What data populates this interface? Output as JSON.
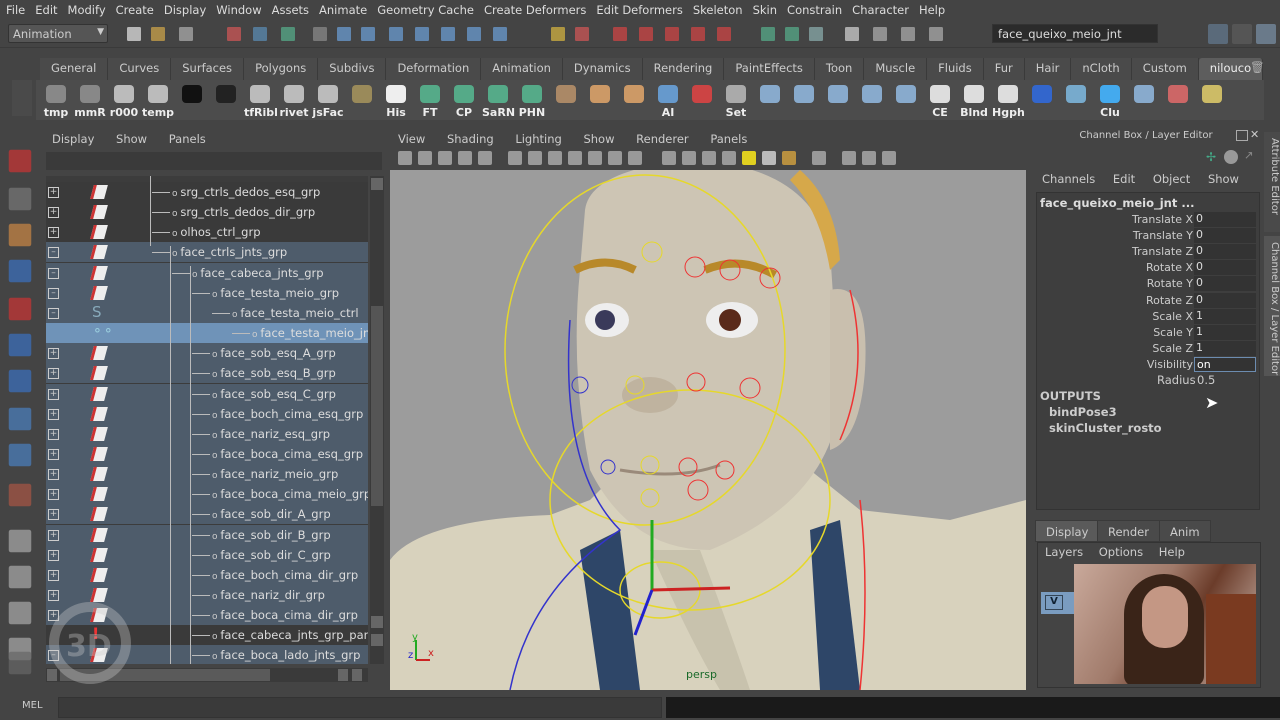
{
  "menubar": [
    "File",
    "Edit",
    "Modify",
    "Create",
    "Display",
    "Window",
    "Assets",
    "Animate",
    "Geometry Cache",
    "Create Deformers",
    "Edit Deformers",
    "Skeleton",
    "Skin",
    "Constrain",
    "Character",
    "Help"
  ],
  "status_line": {
    "mode": "Animation",
    "name_field": "face_queixo_meio_jnt"
  },
  "shelf_tabs": [
    "General",
    "Curves",
    "Surfaces",
    "Polygons",
    "Subdivs",
    "Deformation",
    "Animation",
    "Dynamics",
    "Rendering",
    "PaintEffects",
    "Toon",
    "Muscle",
    "Fluids",
    "Fur",
    "Hair",
    "nCloth",
    "Custom",
    "nilouco"
  ],
  "shelf_active": "nilouco",
  "shelf_buttons": [
    {
      "label": "tmp",
      "icon": "python-icon",
      "color": "#888"
    },
    {
      "label": "mmR",
      "icon": "python-icon",
      "color": "#888"
    },
    {
      "label": "r000",
      "icon": "maya-icon",
      "color": "#bbb"
    },
    {
      "label": "temp",
      "icon": "maya-icon",
      "color": "#bbb"
    },
    {
      "label": "",
      "icon": "3d-logo-icon",
      "color": "#111"
    },
    {
      "label": "",
      "icon": "3d-color-logo-icon",
      "color": "#222"
    },
    {
      "label": "tfRibl",
      "icon": "maya-icon",
      "color": "#bbb"
    },
    {
      "label": "rivet",
      "icon": "maya-icon",
      "color": "#bbb"
    },
    {
      "label": "jsFac",
      "icon": "maya-icon",
      "color": "#bbb"
    },
    {
      "label": "",
      "icon": "cube-icon",
      "color": "#9a8a5a"
    },
    {
      "label": "His",
      "icon": "pencil-icon",
      "color": "#eee"
    },
    {
      "label": "FT",
      "icon": "axes-icon",
      "color": "#5a8"
    },
    {
      "label": "CP",
      "icon": "axes-icon",
      "color": "#5a8"
    },
    {
      "label": "SaRN",
      "icon": "axes-icon",
      "color": "#5a8"
    },
    {
      "label": "PHN",
      "icon": "axes-icon",
      "color": "#5a8"
    },
    {
      "label": "",
      "icon": "skeleton-icon",
      "color": "#a86"
    },
    {
      "label": "",
      "icon": "head-icon",
      "color": "#c96"
    },
    {
      "label": "",
      "icon": "heads-icon",
      "color": "#c96"
    },
    {
      "label": "AI",
      "icon": "joint-icon",
      "color": "#69c"
    },
    {
      "label": "",
      "icon": "paint-icon",
      "color": "#c44"
    },
    {
      "label": "Set",
      "icon": "key-icon",
      "color": "#aaa"
    },
    {
      "label": "",
      "icon": "spheres-icon",
      "color": "#8ac"
    },
    {
      "label": "",
      "icon": "spheres-add-icon",
      "color": "#8ac"
    },
    {
      "label": "",
      "icon": "paint-spheres-icon",
      "color": "#8ac"
    },
    {
      "label": "",
      "icon": "joint-chain-icon",
      "color": "#8ac"
    },
    {
      "label": "",
      "icon": "joint-mirror-icon",
      "color": "#8ac"
    },
    {
      "label": "CE",
      "icon": "window-icon",
      "color": "#ddd"
    },
    {
      "label": "Blnd",
      "icon": "window-icon",
      "color": "#ddd"
    },
    {
      "label": "Hgph",
      "icon": "window-icon",
      "color": "#ddd"
    },
    {
      "label": "",
      "icon": "bone-icon",
      "color": "#36c"
    },
    {
      "label": "",
      "icon": "bucket-icon",
      "color": "#7ac"
    },
    {
      "label": "Clu",
      "icon": "cluster-icon",
      "color": "#4ae"
    },
    {
      "label": "",
      "icon": "paint-weights-icon",
      "color": "#8ac"
    },
    {
      "label": "",
      "icon": "cone-icon",
      "color": "#c66"
    },
    {
      "label": "",
      "icon": "map-icon",
      "color": "#cb6"
    }
  ],
  "outliner": {
    "menu": [
      "Display",
      "Show",
      "Panels"
    ],
    "rows": [
      {
        "name": "srg_ctrls_dedos_esq_grp",
        "level": 0,
        "exp": "+",
        "icon": "transform",
        "bg": "dark"
      },
      {
        "name": "srg_ctrls_dedos_dir_grp",
        "level": 0,
        "exp": "+",
        "icon": "transform",
        "bg": "dark"
      },
      {
        "name": "olhos_ctrl_grp",
        "level": 0,
        "exp": "+",
        "icon": "transform",
        "bg": "dark"
      },
      {
        "name": "face_ctrls_jnts_grp",
        "level": 0,
        "exp": "-",
        "icon": "transform",
        "bg": "sel"
      },
      {
        "name": "face_cabeca_jnts_grp",
        "level": 1,
        "exp": "-",
        "icon": "transform",
        "bg": "sel"
      },
      {
        "name": "face_testa_meio_grp",
        "level": 2,
        "exp": "-",
        "icon": "transform",
        "bg": "sel"
      },
      {
        "name": "face_testa_meio_ctrl",
        "level": 3,
        "exp": "-",
        "icon": "curve",
        "bg": "sel"
      },
      {
        "name": "face_testa_meio_jnt",
        "level": 4,
        "exp": "",
        "icon": "joint",
        "bg": "hi"
      },
      {
        "name": "face_sob_esq_A_grp",
        "level": 2,
        "exp": "+",
        "icon": "transform",
        "bg": "sel"
      },
      {
        "name": "face_sob_esq_B_grp",
        "level": 2,
        "exp": "+",
        "icon": "transform",
        "bg": "sel"
      },
      {
        "name": "face_sob_esq_C_grp",
        "level": 2,
        "exp": "+",
        "icon": "transform",
        "bg": "sel"
      },
      {
        "name": "face_boch_cima_esq_grp",
        "level": 2,
        "exp": "+",
        "icon": "transform",
        "bg": "sel"
      },
      {
        "name": "face_nariz_esq_grp",
        "level": 2,
        "exp": "+",
        "icon": "transform",
        "bg": "sel"
      },
      {
        "name": "face_boca_cima_esq_grp",
        "level": 2,
        "exp": "+",
        "icon": "transform",
        "bg": "sel"
      },
      {
        "name": "face_nariz_meio_grp",
        "level": 2,
        "exp": "+",
        "icon": "transform",
        "bg": "sel"
      },
      {
        "name": "face_boca_cima_meio_grp",
        "level": 2,
        "exp": "+",
        "icon": "transform",
        "bg": "sel"
      },
      {
        "name": "face_sob_dir_A_grp",
        "level": 2,
        "exp": "+",
        "icon": "transform",
        "bg": "sel"
      },
      {
        "name": "face_sob_dir_B_grp",
        "level": 2,
        "exp": "+",
        "icon": "transform",
        "bg": "sel"
      },
      {
        "name": "face_sob_dir_C_grp",
        "level": 2,
        "exp": "+",
        "icon": "transform",
        "bg": "sel"
      },
      {
        "name": "face_boch_cima_dir_grp",
        "level": 2,
        "exp": "+",
        "icon": "transform",
        "bg": "sel"
      },
      {
        "name": "face_nariz_dir_grp",
        "level": 2,
        "exp": "+",
        "icon": "transform",
        "bg": "sel"
      },
      {
        "name": "face_boca_cima_dir_grp",
        "level": 2,
        "exp": "+",
        "icon": "transform",
        "bg": "sel"
      },
      {
        "name": "face_cabeca_jnts_grp_parentC",
        "level": 2,
        "exp": "",
        "icon": "warn",
        "bg": "dark"
      },
      {
        "name": "face_boca_lado_jnts_grp",
        "level": 2,
        "exp": "-",
        "icon": "transform",
        "bg": "sel"
      }
    ]
  },
  "viewport": {
    "menu": [
      "View",
      "Shading",
      "Lighting",
      "Show",
      "Renderer",
      "Panels"
    ],
    "camera_label": "persp",
    "axis": {
      "x": "x",
      "y": "y",
      "z": "z"
    }
  },
  "channel_box": {
    "title": "Channel Box / Layer Editor",
    "menu": [
      "Channels",
      "Edit",
      "Object",
      "Show"
    ],
    "object": "face_queixo_meio_jnt ...",
    "attrs": [
      {
        "name": "Translate X",
        "value": "0"
      },
      {
        "name": "Translate Y",
        "value": "0"
      },
      {
        "name": "Translate Z",
        "value": "0"
      },
      {
        "name": "Rotate X",
        "value": "0"
      },
      {
        "name": "Rotate Y",
        "value": "0"
      },
      {
        "name": "Rotate Z",
        "value": "0"
      },
      {
        "name": "Scale X",
        "value": "1"
      },
      {
        "name": "Scale Y",
        "value": "1"
      },
      {
        "name": "Scale Z",
        "value": "1"
      },
      {
        "name": "Visibility",
        "value": "on"
      }
    ],
    "radius_label": "Radius",
    "radius_value": "0.5",
    "outputs_label": "OUTPUTS",
    "outputs": [
      "bindPose3",
      "skinCluster_rosto"
    ],
    "side_tabs": [
      "Attribute Editor",
      "Channel Box / Layer Editor"
    ]
  },
  "layer_editor": {
    "tabs": [
      "Display",
      "Render",
      "Anim"
    ],
    "menu": [
      "Layers",
      "Options",
      "Help"
    ],
    "layer_visibility": "V"
  },
  "mel": {
    "label": "MEL"
  }
}
